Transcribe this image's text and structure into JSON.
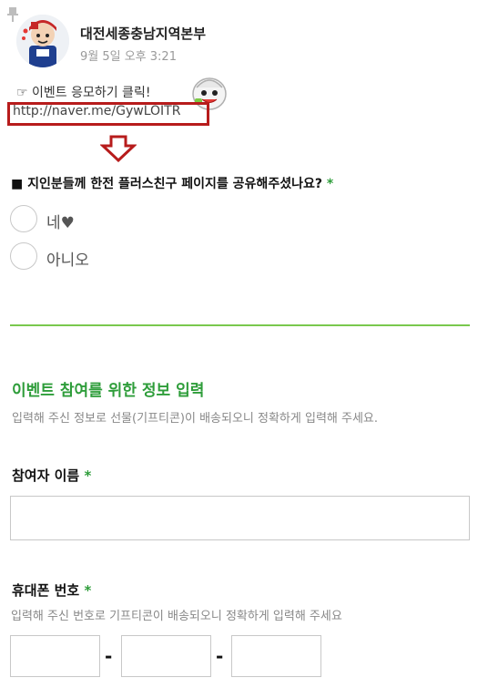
{
  "post": {
    "author": "대전세종충남지역본부",
    "timestamp": "9월 5일 오후 3:21",
    "promo_text": "☞ 이벤트 응모하기 클릭!",
    "link": "http://naver.me/GywLOITR"
  },
  "survey": {
    "question": "■ 지인분들께 한전 플러스친구 페이지를 공유해주셨나요?",
    "required_mark": "*",
    "options": [
      {
        "label": "네♥"
      },
      {
        "label": "아니오"
      }
    ]
  },
  "section": {
    "title": "이벤트 참여를 위한 정보 입력",
    "description": "입력해 주신 정보로 선물(기프티콘)이 배송되오니 정확하게 입력해 주세요."
  },
  "fields": {
    "name_label": "참여자 이름",
    "phone_label": "휴대폰 번호",
    "phone_description": "입력해 주신 번호로 기프티콘이 배송되오니 정확하게 입력해 주세요",
    "dash": "-"
  },
  "colors": {
    "accent_green": "#2e9d3a",
    "divider_green": "#79c84d",
    "highlight_red": "#b71c1c"
  },
  "icons": [
    "pin-icon",
    "mascot-avatar",
    "mascot-sticker",
    "down-arrow-icon"
  ]
}
